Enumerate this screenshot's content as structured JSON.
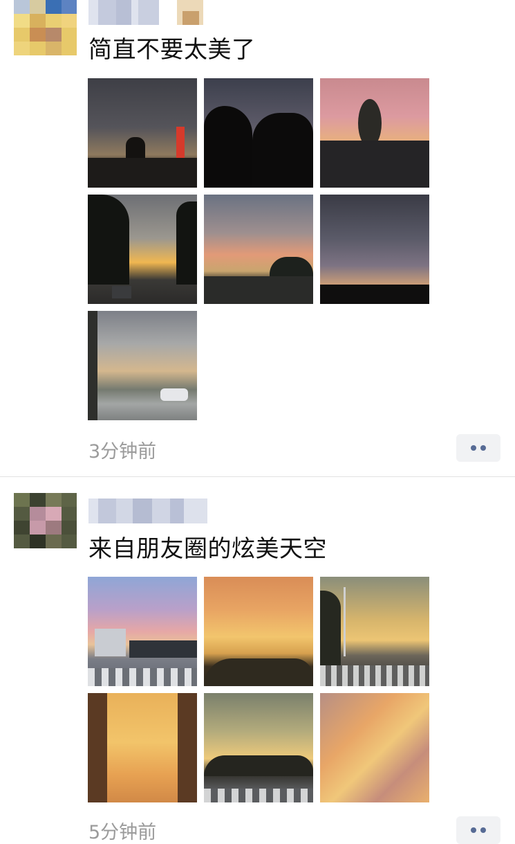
{
  "feed": {
    "posts": [
      {
        "caption": "简直不要太美了",
        "time": "3分钟前",
        "photo_count": 7
      },
      {
        "caption": "来自朋友圈的炫美天空",
        "time": "5分钟前",
        "photo_count": 6
      }
    ]
  },
  "colors": {
    "caption_text": "#111111",
    "meta_text": "#9b9b9b",
    "more_button_bg": "#f1f2f4",
    "more_button_dots": "#576b95",
    "divider": "#e2e2e2"
  },
  "icons": {
    "more": "more-dots-icon"
  }
}
